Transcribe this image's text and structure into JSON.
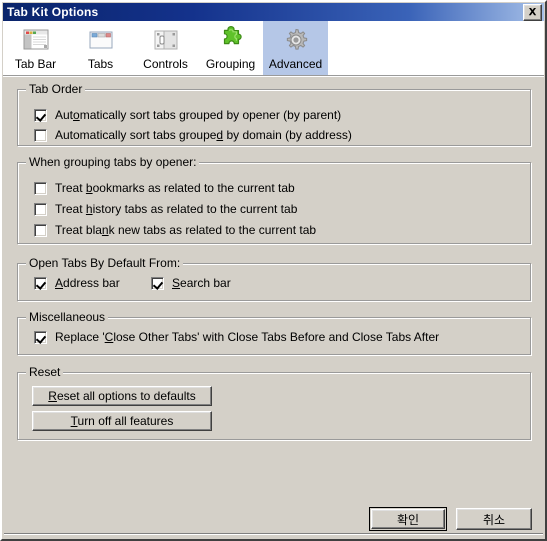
{
  "window": {
    "title": "Tab Kit Options",
    "close_icon": "close-icon"
  },
  "tabs": [
    {
      "label": "Tab Bar",
      "icon": "tab-bar-icon",
      "selected": false
    },
    {
      "label": "Tabs",
      "icon": "tabs-icon",
      "selected": false
    },
    {
      "label": "Controls",
      "icon": "controls-icon",
      "selected": false
    },
    {
      "label": "Grouping",
      "icon": "puzzle-icon",
      "selected": false
    },
    {
      "label": "Advanced",
      "icon": "gear-icon",
      "selected": true
    }
  ],
  "groups": {
    "tab_order": {
      "title": "Tab Order",
      "items": [
        {
          "pre": "Aut",
          "acc": "o",
          "post": "matically sort tabs grouped by opener (by parent)",
          "checked": true
        },
        {
          "pre": "Automatically sort tabs groupe",
          "acc": "d",
          "post": " by domain (by address)",
          "checked": false
        }
      ]
    },
    "when_grouping": {
      "title": "When grouping tabs by opener:",
      "items": [
        {
          "pre": "Treat ",
          "acc": "b",
          "post": "ookmarks as related to the current tab",
          "checked": false
        },
        {
          "pre": "Treat ",
          "acc": "h",
          "post": "istory tabs as related to the current tab",
          "checked": false
        },
        {
          "pre": "Treat bla",
          "acc": "n",
          "post": "k new tabs as related to the current tab",
          "checked": false
        }
      ]
    },
    "open_tabs": {
      "title": "Open Tabs By Default From:",
      "items": [
        {
          "pre": "",
          "acc": "A",
          "post": "ddress bar",
          "checked": true
        },
        {
          "pre": "",
          "acc": "S",
          "post": "earch bar",
          "checked": true
        }
      ]
    },
    "miscellaneous": {
      "title": "Miscellaneous",
      "items": [
        {
          "pre": "Replace '",
          "acc": "C",
          "post": "lose Other Tabs' with Close Tabs Before and Close Tabs After",
          "checked": true
        }
      ]
    },
    "reset": {
      "title": "Reset",
      "buttons": [
        {
          "pre": "",
          "acc": "R",
          "post": "eset all options to defaults"
        },
        {
          "pre": "",
          "acc": "T",
          "post": "urn off all features"
        }
      ]
    }
  },
  "dialog_buttons": {
    "ok": "확인",
    "cancel": "취소"
  },
  "colors": {
    "face": "#d4d0c8",
    "title_start": "#0a246a",
    "title_end": "#a6c0e8",
    "tab_selected": "#b5c7e7",
    "text": "#000000"
  }
}
